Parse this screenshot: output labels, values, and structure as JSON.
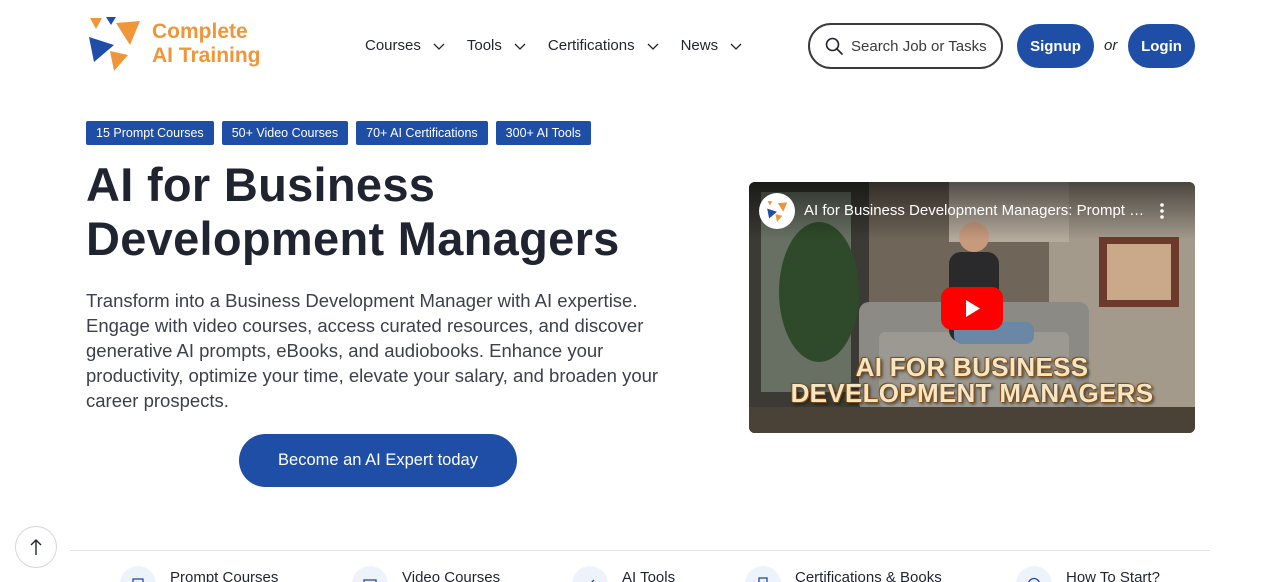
{
  "brand": {
    "name_line1": "Complete",
    "name_line2": "AI Training",
    "color": "#f0963a"
  },
  "nav": {
    "items": [
      {
        "label": "Courses"
      },
      {
        "label": "Tools"
      },
      {
        "label": "Certifications"
      },
      {
        "label": "News"
      }
    ]
  },
  "search": {
    "placeholder": "Search Job or Tasks"
  },
  "auth": {
    "signup": "Signup",
    "or": "or",
    "login": "Login"
  },
  "badges": [
    "15 Prompt Courses",
    "50+ Video Courses",
    "70+ AI Certifications",
    "300+ AI Tools"
  ],
  "hero": {
    "title": "AI for Business Development Managers",
    "description": "Transform into a Business Development Manager with AI expertise. Engage with video courses, access curated resources, and discover generative AI prompts, eBooks, and audiobooks. Enhance your productivity, optimize your time, elevate your salary, and broaden your career prospects.",
    "cta": "Become an AI Expert today"
  },
  "video": {
    "title": "AI for Business Development Managers: Prompt Engineering",
    "overlay_line1": "AI FOR BUSINESS",
    "overlay_line2": "DEVELOPMENT MANAGERS"
  },
  "bottom_nav": [
    {
      "label": "Prompt Courses",
      "icon": "prompt-icon"
    },
    {
      "label": "Video Courses",
      "icon": "video-icon"
    },
    {
      "label": "AI Tools",
      "icon": "tools-icon"
    },
    {
      "label": "Certifications & Books",
      "icon": "book-icon"
    },
    {
      "label": "How To Start?",
      "icon": "help-icon"
    }
  ],
  "colors": {
    "primary": "#1e4ea6",
    "text": "#1f2430",
    "accent": "#f0963a"
  }
}
